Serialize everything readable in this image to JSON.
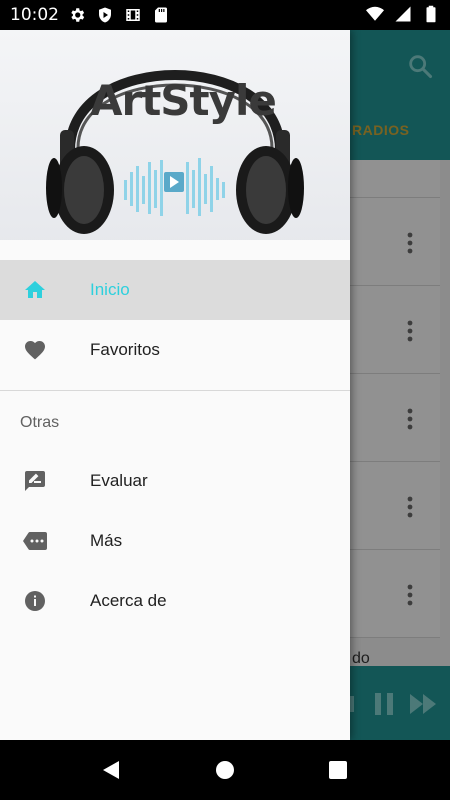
{
  "status_bar": {
    "time": "10:02",
    "icons_left": [
      "gear-icon",
      "shield-icon",
      "film-icon",
      "sd-card-icon"
    ],
    "icons_right": [
      "wifi-icon",
      "cell-signal-icon",
      "battery-icon"
    ]
  },
  "background_app": {
    "tab_label": "RADIOS",
    "partial_text": "do",
    "row_count": 5,
    "colors": {
      "toolbar": "#21908f",
      "tab_label": "#c9a338"
    }
  },
  "drawer": {
    "brand": "ArtStyle",
    "items": [
      {
        "label": "Inicio",
        "icon": "home-icon",
        "active": true
      },
      {
        "label": "Favoritos",
        "icon": "heart-icon",
        "active": false
      }
    ],
    "section_title": "Otras",
    "other_items": [
      {
        "label": "Evaluar",
        "icon": "rate-review-icon"
      },
      {
        "label": "Más",
        "icon": "more-tag-icon"
      },
      {
        "label": "Acerca de",
        "icon": "info-icon"
      }
    ],
    "colors": {
      "active_text": "#2ed0dd",
      "active_bg": "#dcdcdc"
    }
  },
  "nav_bar": {
    "buttons": [
      "back-icon",
      "home-button-icon",
      "recents-icon"
    ]
  }
}
